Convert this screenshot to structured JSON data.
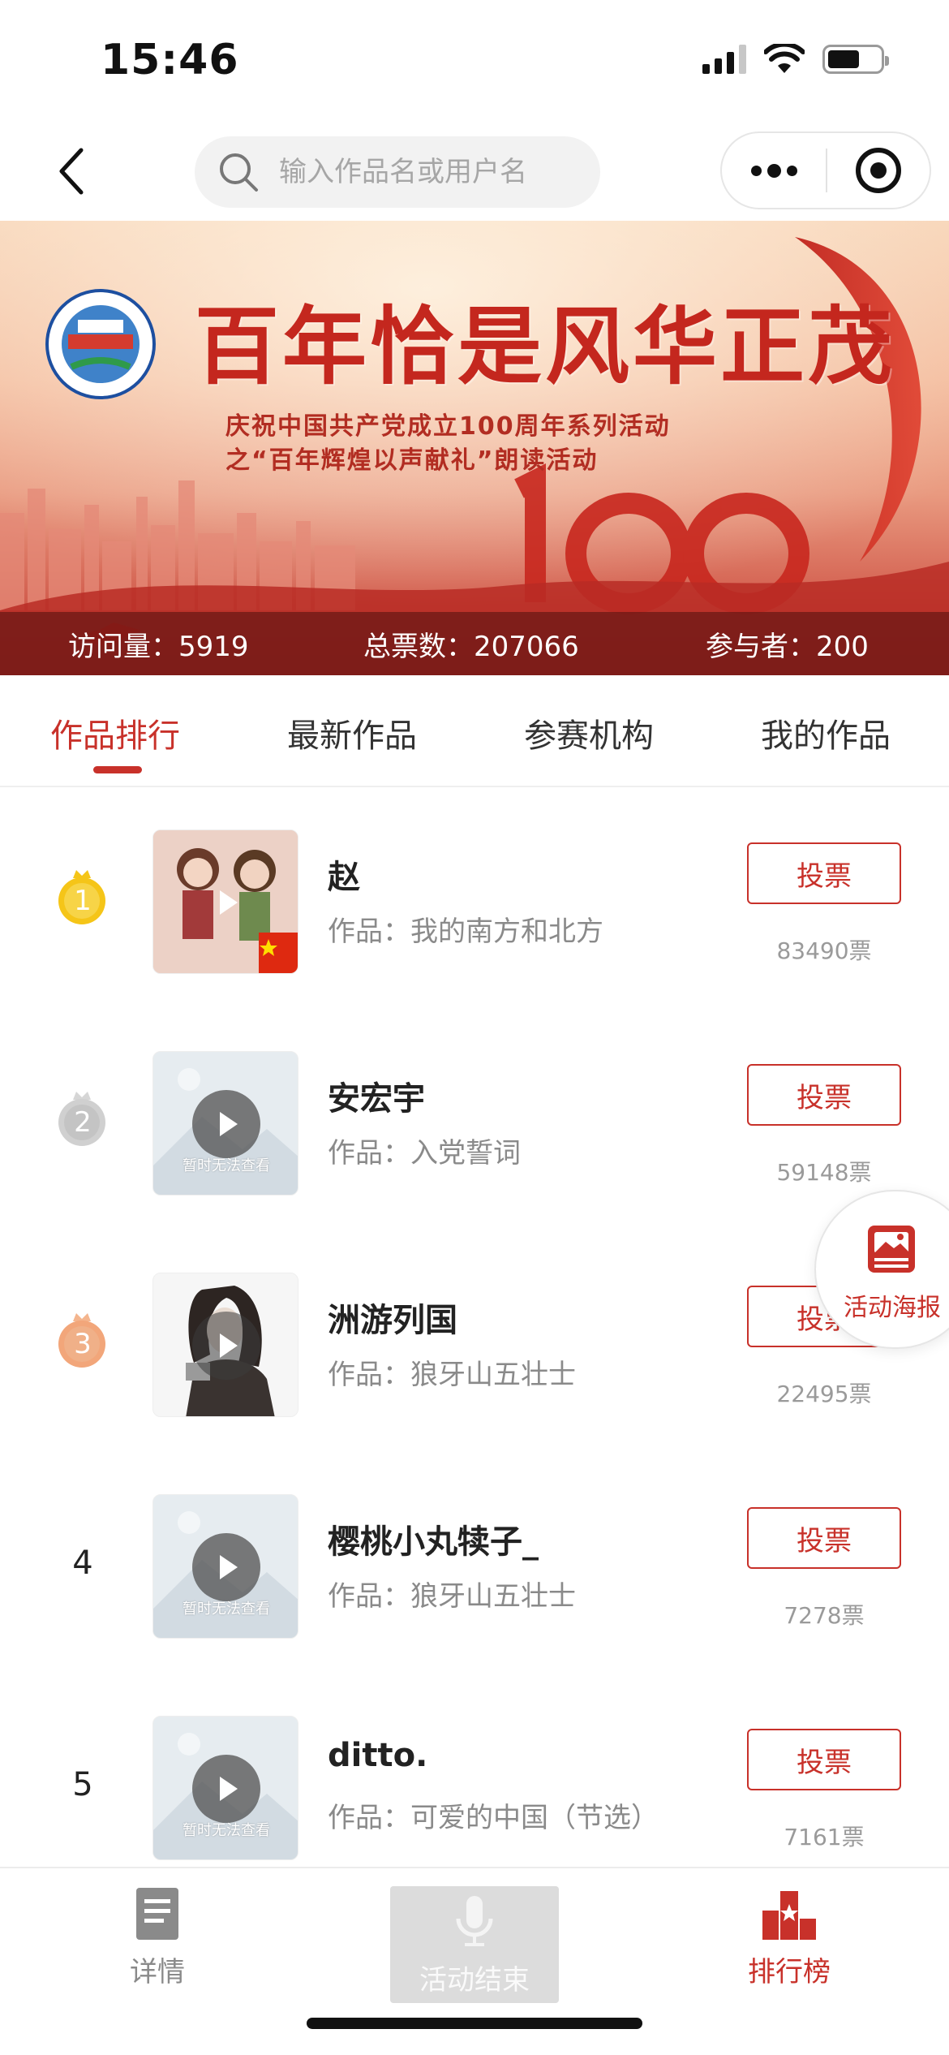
{
  "status_bar": {
    "time": "15:46"
  },
  "nav": {
    "search_placeholder": "输入作品名或用户名"
  },
  "banner": {
    "title": "百年恰是风华正茂",
    "subtitle_line1": "庆祝中国共产党成立100周年系列活动",
    "subtitle_line2": "之“百年辉煌以声献礼”朗读活动",
    "stats": {
      "visits": "访问量：5919",
      "total_votes": "总票数：207066",
      "participants": "参与者：200"
    }
  },
  "tabs": [
    {
      "label": "作品排行",
      "active": true
    },
    {
      "label": "最新作品",
      "active": false
    },
    {
      "label": "参赛机构",
      "active": false
    },
    {
      "label": "我的作品",
      "active": false
    }
  ],
  "ranking": [
    {
      "rank": "1",
      "medal": "gold",
      "name": "赵",
      "work": "作品：我的南方和北方",
      "vote_label": "投票",
      "votes": "83490票",
      "thumb": "dolls-photo"
    },
    {
      "rank": "2",
      "medal": "silver",
      "name": "安宏宇",
      "work": "作品：入党誓词",
      "vote_label": "投票",
      "votes": "59148票",
      "thumb": "placeholder",
      "thumb_text": "暂时无法查看"
    },
    {
      "rank": "3",
      "medal": "bronze",
      "name": "洲游列国",
      "work": "作品：狼牙山五壮士",
      "vote_label": "投票",
      "votes": "22495票",
      "thumb": "sketch-portrait"
    },
    {
      "rank": "4",
      "medal": "",
      "name": "樱桃小丸犊子_",
      "work": "作品：狼牙山五壮士",
      "vote_label": "投票",
      "votes": "7278票",
      "thumb": "placeholder",
      "thumb_text": "暂时无法查看"
    },
    {
      "rank": "5",
      "medal": "",
      "name": "ditto.",
      "work": "作品：可爱的中国（节选）",
      "vote_label": "投票",
      "votes": "7161票",
      "thumb": "placeholder",
      "thumb_text": "暂时无法查看"
    }
  ],
  "poster_button": {
    "label": "活动海报"
  },
  "bottom_bar": {
    "details": "详情",
    "ended": "活动结束",
    "leaderboard": "排行榜"
  },
  "colors": {
    "accent": "#c8312a",
    "gold": "#f5c518",
    "silver": "#c8c8c8",
    "bronze": "#f2a67a"
  }
}
